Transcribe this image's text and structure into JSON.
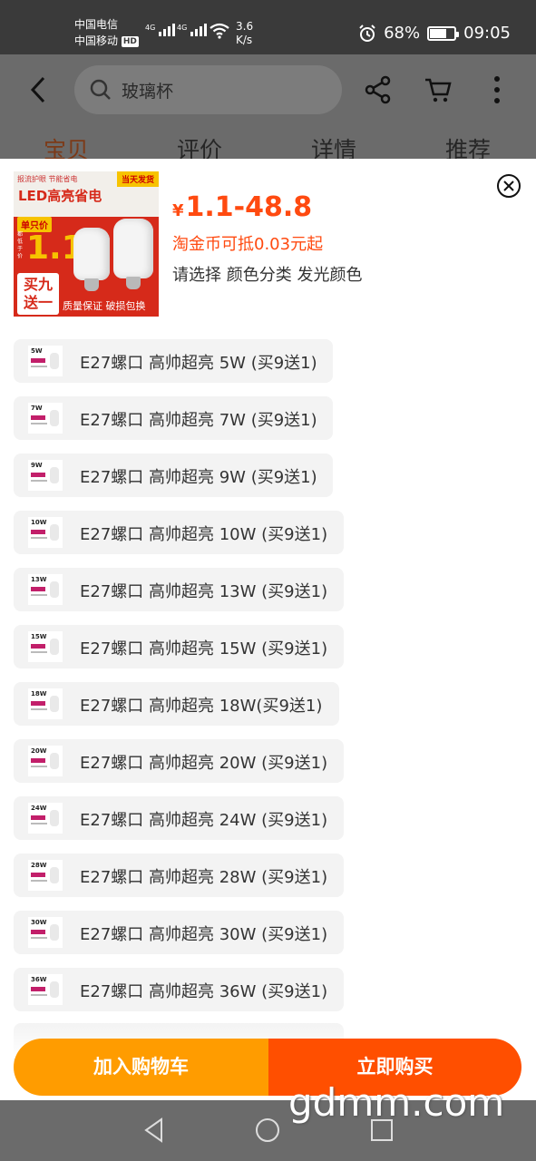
{
  "status_bar": {
    "carrier1": "中国电信",
    "carrier2": "中国移动",
    "hd": "HD",
    "net1": "4G",
    "net2": "4G",
    "speed_value": "3.6",
    "speed_unit": "K/s",
    "battery": "68%",
    "battery_level": 0.68,
    "time": "09:05"
  },
  "header": {
    "search_text": "玻璃杯",
    "tabs": [
      {
        "label": "宝贝",
        "active": true
      },
      {
        "label": "评价",
        "active": false
      },
      {
        "label": "详情",
        "active": false
      },
      {
        "label": "推荐",
        "active": false
      }
    ]
  },
  "product_image": {
    "strip": "报流护眼 节能省电",
    "badge": "当天发货",
    "headline": "LED高亮省电",
    "unit_tag": "单只价",
    "small_label": "都低于价",
    "price_text": "1.1",
    "promo": "买九送一",
    "footer": "质量保证 破损包换"
  },
  "sku": {
    "currency": "¥",
    "price_range": "1.1-48.8",
    "coin_offer": "淘金币可抵0.03元起",
    "select_prompt": "请选择 颜色分类 发光颜色"
  },
  "options": [
    {
      "label": "E27螺口 高帅超亮 5W (买9送1)",
      "watt": "5W"
    },
    {
      "label": "E27螺口 高帅超亮 7W (买9送1)",
      "watt": "7W"
    },
    {
      "label": "E27螺口 高帅超亮 9W (买9送1)",
      "watt": "9W"
    },
    {
      "label": "E27螺口 高帅超亮 10W (买9送1)",
      "watt": "10W"
    },
    {
      "label": "E27螺口 高帅超亮 13W (买9送1)",
      "watt": "13W"
    },
    {
      "label": "E27螺口 高帅超亮 15W (买9送1)",
      "watt": "15W"
    },
    {
      "label": "E27螺口 高帅超亮 18W(买9送1)",
      "watt": "18W"
    },
    {
      "label": "E27螺口 高帅超亮 20W (买9送1)",
      "watt": "20W"
    },
    {
      "label": "E27螺口 高帅超亮 24W (买9送1)",
      "watt": "24W"
    },
    {
      "label": "E27螺口 高帅超亮 28W (买9送1)",
      "watt": "28W"
    },
    {
      "label": "E27螺口 高帅超亮 30W (买9送1)",
      "watt": "30W"
    },
    {
      "label": "E27螺口 高帅超亮 36W (买9送1)",
      "watt": "36W"
    }
  ],
  "actions": {
    "add_to_cart": "加入购物车",
    "buy_now": "立即购买"
  },
  "watermark": "gdmm.com",
  "colors": {
    "accent": "#ff4a10",
    "cart_button": "#ff9c00",
    "buy_button": "#ff4f00",
    "option_bg": "#f3f3f3",
    "overlay": "#6b6b6b"
  },
  "icons": [
    "back-icon",
    "search-icon",
    "share-icon",
    "cart-icon",
    "more-icon",
    "close-icon",
    "nav-back-icon",
    "nav-home-icon",
    "nav-recents-icon"
  ]
}
